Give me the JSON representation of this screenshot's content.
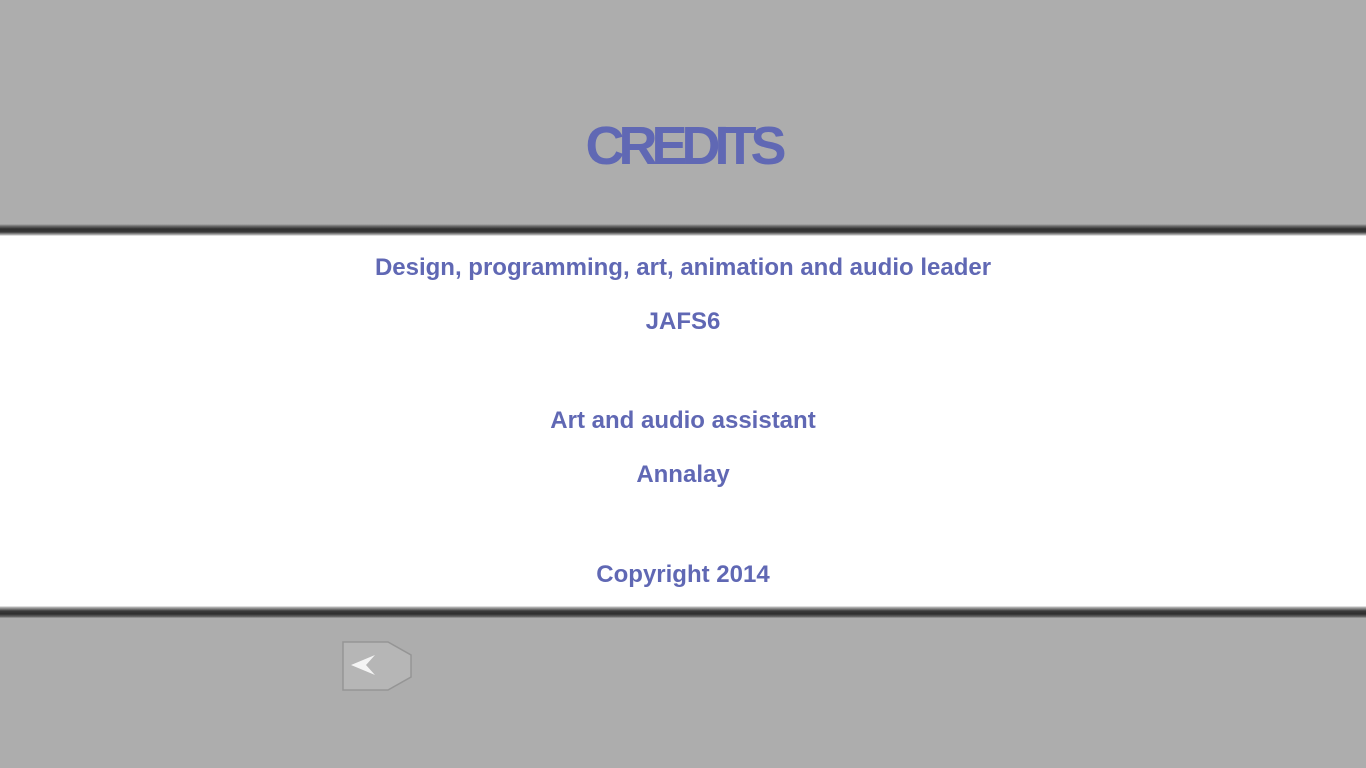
{
  "screen": {
    "title": "CREDITS",
    "credits": [
      {
        "role": "Design, programming, art, animation and audio leader",
        "name": "JAFS6"
      },
      {
        "role": "Art and audio assistant",
        "name": "Annalay"
      }
    ],
    "copyright": "Copyright 2014"
  },
  "navigation": {
    "back_icon": "back-arrow-icon"
  },
  "colors": {
    "text": "#6068b4",
    "background": "#adadad",
    "band": "#ffffff"
  }
}
